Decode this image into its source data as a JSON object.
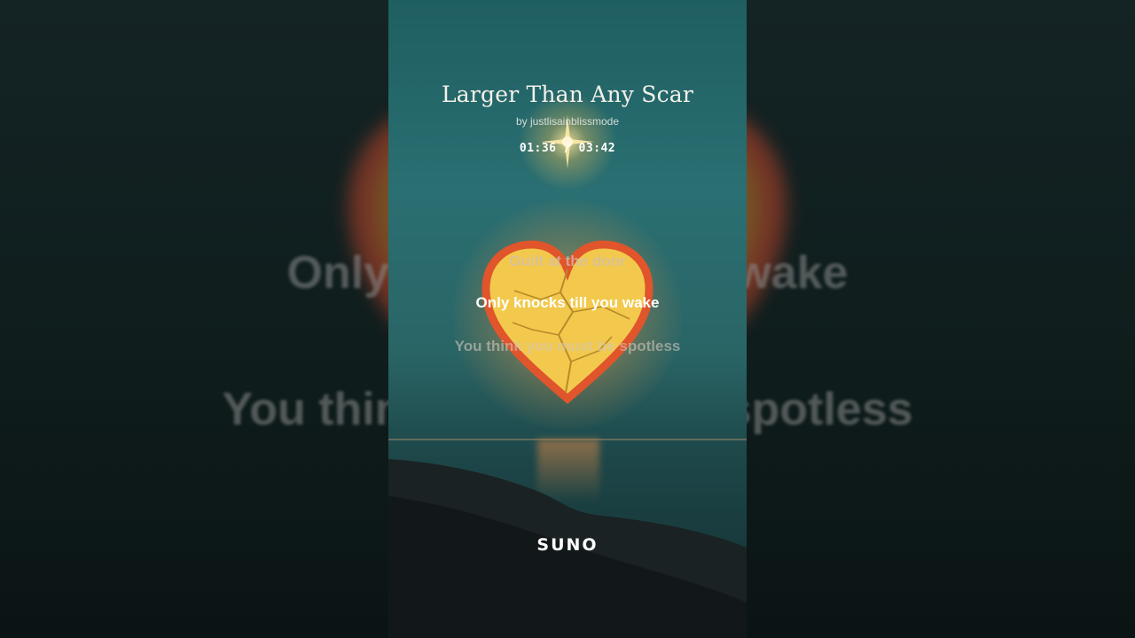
{
  "song": {
    "title": "Larger Than Any Scar",
    "artist_line": "by justlisainblissmode",
    "elapsed": "01:36",
    "separator": " / ",
    "duration": "03:42",
    "time_display": "01:36 / 03:42"
  },
  "lyrics": {
    "previous": "Guilt at the door",
    "current": "Only knocks till you wake",
    "next": "You think you must be spotless"
  },
  "background_lyrics": {
    "top": "Guilt at the door",
    "middle": "Only knocks till you wake",
    "bottom": "You think you must be spotless"
  },
  "brand": {
    "logo_text": "SUNO"
  },
  "colors": {
    "card_top": "#1f5f61",
    "heart_fill": "#f2c94c",
    "heart_outline": "#e0552b",
    "text": "#ffffff"
  }
}
